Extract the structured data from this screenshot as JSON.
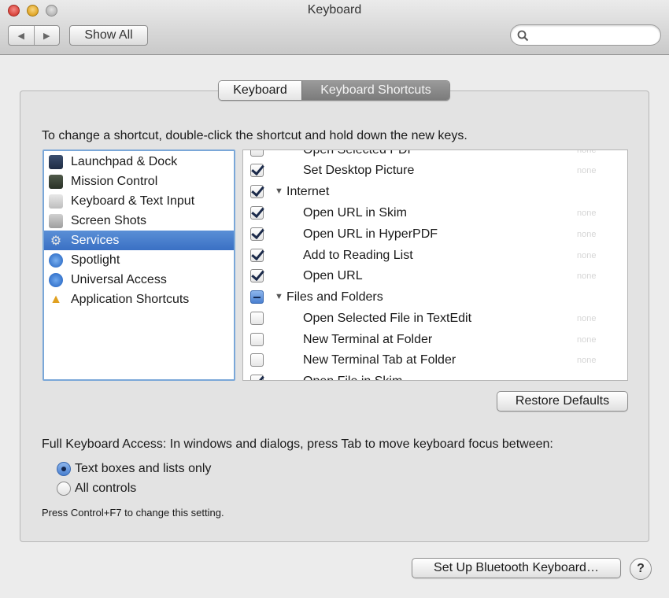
{
  "window": {
    "title": "Keyboard",
    "back_glyph": "◀",
    "forward_glyph": "▶",
    "show_all_label": "Show All",
    "search_placeholder": ""
  },
  "tabs": [
    {
      "label": "Keyboard",
      "active": false
    },
    {
      "label": "Keyboard Shortcuts",
      "active": true
    }
  ],
  "instruction": "To change a shortcut, double-click the shortcut and hold down the new keys.",
  "categories": [
    {
      "label": "Launchpad & Dock",
      "icon": "launchpad-dock-icon",
      "selected": false
    },
    {
      "label": "Mission Control",
      "icon": "mission-control-icon",
      "selected": false
    },
    {
      "label": "Keyboard & Text Input",
      "icon": "keyboard-text-icon",
      "selected": false
    },
    {
      "label": "Screen Shots",
      "icon": "screen-shots-icon",
      "selected": false
    },
    {
      "label": "Services",
      "icon": "gear-icon",
      "selected": true
    },
    {
      "label": "Spotlight",
      "icon": "spotlight-icon",
      "selected": false
    },
    {
      "label": "Universal Access",
      "icon": "universal-access-icon",
      "selected": false
    },
    {
      "label": "Application Shortcuts",
      "icon": "application-shortcuts-icon",
      "selected": false
    }
  ],
  "shortcuts": [
    {
      "label": "Open Selected PDF",
      "state": "unchecked",
      "group": false,
      "shortcut": "none"
    },
    {
      "label": "Set Desktop Picture",
      "state": "checked",
      "group": false,
      "shortcut": "none"
    },
    {
      "label": "Internet",
      "state": "checked",
      "group": true,
      "shortcut": ""
    },
    {
      "label": "Open URL in Skim",
      "state": "checked",
      "group": false,
      "shortcut": "none"
    },
    {
      "label": "Open URL in HyperPDF",
      "state": "checked",
      "group": false,
      "shortcut": "none"
    },
    {
      "label": "Add to Reading List",
      "state": "checked",
      "group": false,
      "shortcut": "none"
    },
    {
      "label": "Open URL",
      "state": "checked",
      "group": false,
      "shortcut": "none"
    },
    {
      "label": "Files and Folders",
      "state": "mixed",
      "group": true,
      "shortcut": ""
    },
    {
      "label": "Open Selected File in TextEdit",
      "state": "unchecked",
      "group": false,
      "shortcut": "none"
    },
    {
      "label": "New Terminal at Folder",
      "state": "unchecked",
      "group": false,
      "shortcut": "none"
    },
    {
      "label": "New Terminal Tab at Folder",
      "state": "unchecked",
      "group": false,
      "shortcut": "none"
    },
    {
      "label": "Open File in Skim",
      "state": "checked",
      "group": false,
      "shortcut": ""
    }
  ],
  "group_triangle": "▼",
  "restore_defaults_label": "Restore Defaults",
  "full_keyboard_access": "Full Keyboard Access: In windows and dialogs, press Tab to move keyboard focus between:",
  "radio_options": [
    {
      "label": "Text boxes and lists only",
      "selected": true
    },
    {
      "label": "All controls",
      "selected": false
    }
  ],
  "hint": "Press Control+F7 to change this setting.",
  "bluetooth_label": "Set Up Bluetooth Keyboard…",
  "help_label": "?",
  "colors": {
    "selection": "#3a70c4",
    "focus_ring": "#7aa7d8"
  }
}
